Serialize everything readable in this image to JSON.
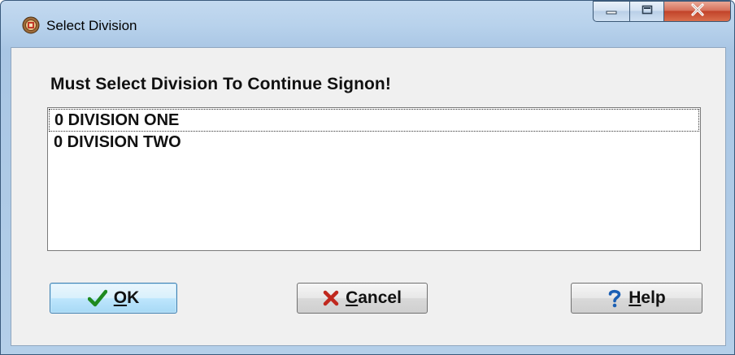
{
  "window": {
    "title": "Select Division",
    "app_icon": "app-icon",
    "caption_buttons": [
      "minimize-icon",
      "maximize-icon",
      "close-icon"
    ]
  },
  "dialog": {
    "prompt": "Must Select Division To Continue Signon!",
    "divisions": [
      {
        "label": "0 DIVISION ONE",
        "focused": true
      },
      {
        "label": "0 DIVISION TWO",
        "focused": false
      }
    ],
    "buttons": {
      "ok": {
        "hotkey": "O",
        "rest": "K",
        "icon": "checkmark-icon",
        "icon_color": "#1f8a1f"
      },
      "cancel": {
        "hotkey": "C",
        "rest": "ancel",
        "icon": "x-mark-icon",
        "icon_color": "#c0281e"
      },
      "help": {
        "hotkey": "H",
        "rest": "elp",
        "icon": "question-icon",
        "icon_color": "#1a5fb4"
      }
    }
  }
}
